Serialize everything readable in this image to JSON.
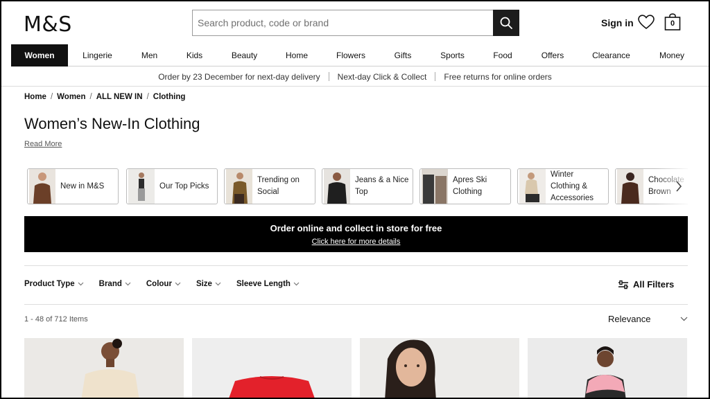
{
  "header": {
    "logo": "M&S",
    "search_placeholder": "Search product, code or brand",
    "sign_in": "Sign in",
    "bag_count": "0"
  },
  "nav": {
    "items": [
      {
        "label": "Women",
        "active": true
      },
      {
        "label": "Lingerie"
      },
      {
        "label": "Men"
      },
      {
        "label": "Kids"
      },
      {
        "label": "Beauty"
      },
      {
        "label": "Home"
      },
      {
        "label": "Flowers"
      },
      {
        "label": "Gifts"
      },
      {
        "label": "Sports"
      },
      {
        "label": "Food"
      },
      {
        "label": "Offers"
      },
      {
        "label": "Clearance"
      },
      {
        "label": "Money"
      }
    ]
  },
  "promo_strip": [
    "Order by 23 December for next-day delivery",
    "Next-day Click & Collect",
    "Free returns for online orders"
  ],
  "breadcrumb": [
    "Home",
    "Women",
    "ALL NEW IN",
    "Clothing"
  ],
  "page": {
    "title": "Women’s New-In Clothing",
    "read_more": "Read More"
  },
  "chips": [
    {
      "label_lines": [
        "New in M&S"
      ],
      "thumb_color": "#6b3f28"
    },
    {
      "label_lines": [
        "Our Top Picks"
      ],
      "thumb_color": "#2d2d2d"
    },
    {
      "label_lines": [
        "Trending on",
        "Social"
      ],
      "thumb_color": "#7a5a2a"
    },
    {
      "label_lines": [
        "Jeans & a Nice",
        "Top"
      ],
      "thumb_color": "#1f1f1f"
    },
    {
      "label_lines": [
        "Apres Ski",
        "Clothing"
      ],
      "thumb_color": "#8a7666"
    },
    {
      "label_lines": [
        "Winter",
        "Clothing &",
        "Accessories"
      ],
      "thumb_color": "#b59f84"
    },
    {
      "label_lines": [
        "Chocolate",
        "Brown"
      ],
      "thumb_color": "#4a2a1e"
    }
  ],
  "banner": {
    "title": "Order online and collect in store for free",
    "link": "Click here for more details"
  },
  "filters": [
    {
      "label": "Product Type"
    },
    {
      "label": "Brand"
    },
    {
      "label": "Colour"
    },
    {
      "label": "Size"
    },
    {
      "label": "Sleeve Length"
    }
  ],
  "all_filters": "All Filters",
  "results": {
    "count": "1 - 48 of 712 Items",
    "sort": "Relevance"
  },
  "products": [
    {
      "garment_color": "#efe2cc"
    },
    {
      "garment_color": "#e3212b"
    },
    {
      "garment_color": "#2a2a2a"
    },
    {
      "garment_color": "#f3a9b7"
    }
  ]
}
